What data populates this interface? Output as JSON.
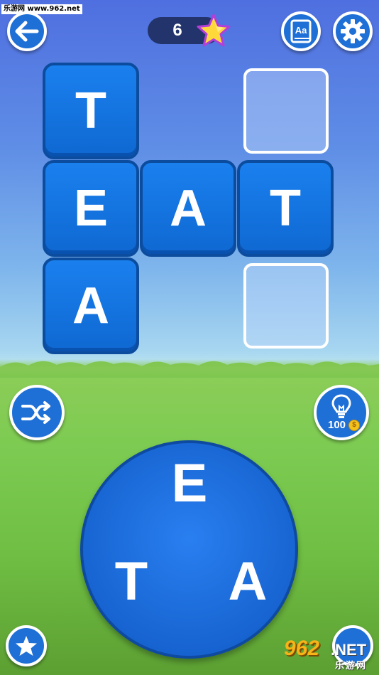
{
  "watermark": "乐游网 www.962.net",
  "header": {
    "score": "6",
    "back_icon": "arrow-left-icon",
    "dictionary_icon": "dictionary-icon",
    "dictionary_text": "Aa",
    "settings_icon": "gear-icon",
    "star_icon": "star-icon"
  },
  "board": {
    "tiles": [
      "T",
      "E",
      "A",
      "T",
      "A"
    ],
    "empty_slots": 2
  },
  "controls": {
    "shuffle_icon": "shuffle-icon",
    "hint_icon": "lightbulb-icon",
    "hint_cost": "100",
    "coin_symbol": "$",
    "star_button_icon": "star-icon"
  },
  "wheel": {
    "letters": [
      "E",
      "T",
      "A"
    ]
  },
  "site_logo": {
    "number": "962",
    "net": ".NET",
    "subtitle": "乐游网"
  },
  "colors": {
    "tile_blue": "#1a80ee",
    "tile_border": "#0c4c9e",
    "button_blue": "#1e6fd6",
    "score_pill": "#22346b",
    "star_yellow": "#ffd93a",
    "star_outline": "#b33fd8"
  }
}
